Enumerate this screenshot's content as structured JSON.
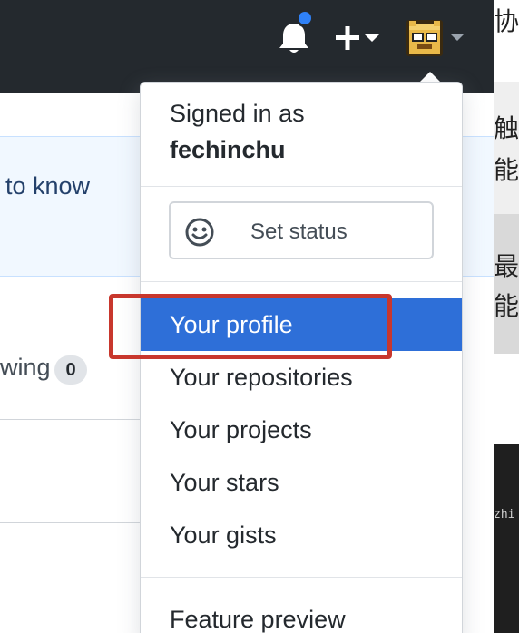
{
  "header": {
    "notifications_icon": "bell-icon",
    "create_icon": "plus-icon",
    "avatar_icon": "avatar"
  },
  "page": {
    "banner_text": "to know",
    "following_text": "wing",
    "following_count": "0"
  },
  "side_window": {
    "chars": [
      "协",
      "触",
      "能",
      "最",
      "能"
    ],
    "terminal_text": "zhi"
  },
  "dropdown": {
    "signed_in_label": "Signed in as",
    "username": "fechinchu",
    "set_status": "Set status",
    "items": [
      {
        "label": "Your profile",
        "active": true
      },
      {
        "label": "Your repositories",
        "active": false
      },
      {
        "label": "Your projects",
        "active": false
      },
      {
        "label": "Your stars",
        "active": false
      },
      {
        "label": "Your gists",
        "active": false
      }
    ],
    "feature_preview": "Feature preview"
  },
  "colors": {
    "header_bg": "#24292e",
    "active_item": "#2e6fd8",
    "highlight_border": "#c8372d",
    "notif_dot": "#2f81f7"
  }
}
